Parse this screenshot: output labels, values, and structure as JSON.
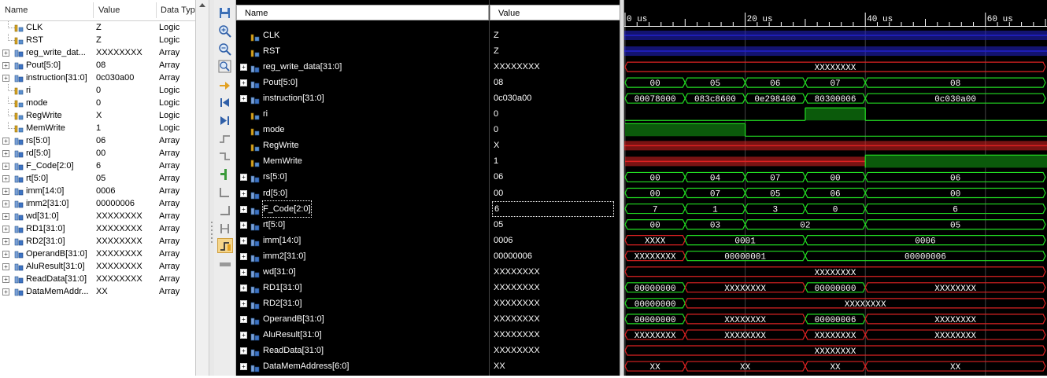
{
  "objects_panel": {
    "columns": [
      "Name",
      "Value",
      "Data Typ"
    ],
    "rows": [
      {
        "name": "CLK",
        "value": "Z",
        "type": "Logic",
        "kind": "logic",
        "expandable": false
      },
      {
        "name": "RST",
        "value": "Z",
        "type": "Logic",
        "kind": "logic",
        "expandable": false
      },
      {
        "name": "reg_write_dat...",
        "value": "XXXXXXXX",
        "type": "Array",
        "kind": "array",
        "expandable": true
      },
      {
        "name": "Pout[5:0]",
        "value": "08",
        "type": "Array",
        "kind": "array",
        "expandable": true
      },
      {
        "name": "instruction[31:0]",
        "value": "0c030a00",
        "type": "Array",
        "kind": "array",
        "expandable": true
      },
      {
        "name": "ri",
        "value": "0",
        "type": "Logic",
        "kind": "logic",
        "expandable": false
      },
      {
        "name": "mode",
        "value": "0",
        "type": "Logic",
        "kind": "logic",
        "expandable": false
      },
      {
        "name": "RegWrite",
        "value": "X",
        "type": "Logic",
        "kind": "logic",
        "expandable": false
      },
      {
        "name": "MemWrite",
        "value": "1",
        "type": "Logic",
        "kind": "logic",
        "expandable": false
      },
      {
        "name": "rs[5:0]",
        "value": "06",
        "type": "Array",
        "kind": "array",
        "expandable": true
      },
      {
        "name": "rd[5:0]",
        "value": "00",
        "type": "Array",
        "kind": "array",
        "expandable": true
      },
      {
        "name": "F_Code[2:0]",
        "value": "6",
        "type": "Array",
        "kind": "array",
        "expandable": true
      },
      {
        "name": "rt[5:0]",
        "value": "05",
        "type": "Array",
        "kind": "array",
        "expandable": true
      },
      {
        "name": "imm[14:0]",
        "value": "0006",
        "type": "Array",
        "kind": "array",
        "expandable": true
      },
      {
        "name": "imm2[31:0]",
        "value": "00000006",
        "type": "Array",
        "kind": "array",
        "expandable": true
      },
      {
        "name": "wd[31:0]",
        "value": "XXXXXXXX",
        "type": "Array",
        "kind": "array",
        "expandable": true
      },
      {
        "name": "RD1[31:0]",
        "value": "XXXXXXXX",
        "type": "Array",
        "kind": "array",
        "expandable": true
      },
      {
        "name": "RD2[31:0]",
        "value": "XXXXXXXX",
        "type": "Array",
        "kind": "array",
        "expandable": true
      },
      {
        "name": "OperandB[31:0]",
        "value": "XXXXXXXX",
        "type": "Array",
        "kind": "array",
        "expandable": true
      },
      {
        "name": "AluResult[31:0]",
        "value": "XXXXXXXX",
        "type": "Array",
        "kind": "array",
        "expandable": true
      },
      {
        "name": "ReadData[31:0]",
        "value": "XXXXXXXX",
        "type": "Array",
        "kind": "array",
        "expandable": true
      },
      {
        "name": "DataMemAddr...",
        "value": "XX",
        "type": "Array",
        "kind": "array",
        "expandable": true
      }
    ]
  },
  "toolbar_icons": [
    "save-icon",
    "zoom-in-icon",
    "zoom-out-icon",
    "zoom-fit-icon",
    "zoom-cursor-icon",
    "go-to-start-icon",
    "go-to-end-icon",
    "previous-transition-icon",
    "next-transition-icon",
    "add-marker-icon",
    "previous-marker-icon",
    "next-marker-icon",
    "swap-cursors-icon",
    "snap-to-transition-icon",
    "floating-ruler-icon"
  ],
  "wave_window": {
    "name_header": "Name",
    "value_header": "Value",
    "colors": {
      "green": "#22dd22",
      "red": "#dd2222",
      "blue": "#2222cc",
      "text": "#ffffff",
      "bg": "#000000",
      "rule": "#ffffff"
    },
    "time": {
      "start": 0,
      "end": 70,
      "unit": "us",
      "major_ticks": [
        0,
        20,
        40,
        60
      ],
      "minor_step": 2,
      "tick_labels": [
        "0 us",
        "20 us",
        "40 us",
        "60 us"
      ]
    },
    "signals": [
      {
        "name": "CLK",
        "value": "Z",
        "kind": "logic",
        "expandable": false,
        "state": "Z",
        "color": "blue"
      },
      {
        "name": "RST",
        "value": "Z",
        "kind": "logic",
        "expandable": false,
        "state": "Z",
        "color": "blue"
      },
      {
        "name": "reg_write_data[31:0]",
        "value": "XXXXXXXX",
        "kind": "array",
        "expandable": true,
        "segments": [
          {
            "t": 0,
            "label": "XXXXXXXX",
            "color": "red"
          }
        ]
      },
      {
        "name": "Pout[5:0]",
        "value": "08",
        "kind": "array",
        "expandable": true,
        "segments": [
          {
            "t": 0,
            "label": "00"
          },
          {
            "t": 10,
            "label": "05"
          },
          {
            "t": 20,
            "label": "06"
          },
          {
            "t": 30,
            "label": "07"
          },
          {
            "t": 40,
            "label": "08"
          }
        ]
      },
      {
        "name": "instruction[31:0]",
        "value": "0c030a00",
        "kind": "array",
        "expandable": true,
        "segments": [
          {
            "t": 0,
            "label": "00078000"
          },
          {
            "t": 10,
            "label": "083c8600"
          },
          {
            "t": 20,
            "label": "0e298400"
          },
          {
            "t": 30,
            "label": "80300006"
          },
          {
            "t": 40,
            "label": "0c030a00"
          }
        ]
      },
      {
        "name": "ri",
        "value": "0",
        "kind": "logic",
        "expandable": false,
        "levels": [
          {
            "t": 0,
            "v": 0
          },
          {
            "t": 30,
            "v": 1
          },
          {
            "t": 40,
            "v": 0
          }
        ]
      },
      {
        "name": "mode",
        "value": "0",
        "kind": "logic",
        "expandable": false,
        "levels": [
          {
            "t": 0,
            "v": 1
          },
          {
            "t": 20,
            "v": 0
          }
        ]
      },
      {
        "name": "RegWrite",
        "value": "X",
        "kind": "logic",
        "expandable": false,
        "state": "X",
        "color": "red"
      },
      {
        "name": "MemWrite",
        "value": "1",
        "kind": "logic",
        "expandable": false,
        "levels": [
          {
            "t": 0,
            "v": "X"
          },
          {
            "t": 40,
            "v": 1
          }
        ]
      },
      {
        "name": "rs[5:0]",
        "value": "06",
        "kind": "array",
        "expandable": true,
        "segments": [
          {
            "t": 0,
            "label": "00"
          },
          {
            "t": 10,
            "label": "04"
          },
          {
            "t": 20,
            "label": "07"
          },
          {
            "t": 30,
            "label": "00"
          },
          {
            "t": 40,
            "label": "06"
          }
        ]
      },
      {
        "name": "rd[5:0]",
        "value": "00",
        "kind": "array",
        "expandable": true,
        "segments": [
          {
            "t": 0,
            "label": "00"
          },
          {
            "t": 10,
            "label": "07"
          },
          {
            "t": 20,
            "label": "05"
          },
          {
            "t": 30,
            "label": "06"
          },
          {
            "t": 40,
            "label": "00"
          }
        ]
      },
      {
        "name": "F_Code[2:0]",
        "value": "6",
        "kind": "array",
        "expandable": true,
        "selected": true,
        "segments": [
          {
            "t": 0,
            "label": "7"
          },
          {
            "t": 10,
            "label": "1"
          },
          {
            "t": 20,
            "label": "3"
          },
          {
            "t": 30,
            "label": "0"
          },
          {
            "t": 40,
            "label": "6"
          }
        ]
      },
      {
        "name": "rt[5:0]",
        "value": "05",
        "kind": "array",
        "expandable": true,
        "segments": [
          {
            "t": 0,
            "label": "00"
          },
          {
            "t": 10,
            "label": "03"
          },
          {
            "t": 20,
            "label": "02"
          },
          {
            "t": 40,
            "label": "05"
          }
        ]
      },
      {
        "name": "imm[14:0]",
        "value": "0006",
        "kind": "array",
        "expandable": true,
        "segments": [
          {
            "t": 0,
            "label": "XXXX",
            "color": "red"
          },
          {
            "t": 10,
            "label": "0001"
          },
          {
            "t": 30,
            "label": "0006"
          }
        ]
      },
      {
        "name": "imm2[31:0]",
        "value": "00000006",
        "kind": "array",
        "expandable": true,
        "segments": [
          {
            "t": 0,
            "label": "XXXXXXXX",
            "color": "red"
          },
          {
            "t": 10,
            "label": "00000001"
          },
          {
            "t": 30,
            "label": "00000006"
          }
        ]
      },
      {
        "name": "wd[31:0]",
        "value": "XXXXXXXX",
        "kind": "array",
        "expandable": true,
        "segments": [
          {
            "t": 0,
            "label": "XXXXXXXX",
            "color": "red"
          }
        ]
      },
      {
        "name": "RD1[31:0]",
        "value": "XXXXXXXX",
        "kind": "array",
        "expandable": true,
        "segments": [
          {
            "t": 0,
            "label": "00000000"
          },
          {
            "t": 10,
            "label": "XXXXXXXX",
            "color": "red"
          },
          {
            "t": 30,
            "label": "00000000"
          },
          {
            "t": 40,
            "label": "XXXXXXXX",
            "color": "red"
          }
        ]
      },
      {
        "name": "RD2[31:0]",
        "value": "XXXXXXXX",
        "kind": "array",
        "expandable": true,
        "segments": [
          {
            "t": 0,
            "label": "00000000"
          },
          {
            "t": 10,
            "label": "XXXXXXXX",
            "color": "red"
          }
        ]
      },
      {
        "name": "OperandB[31:0]",
        "value": "XXXXXXXX",
        "kind": "array",
        "expandable": true,
        "segments": [
          {
            "t": 0,
            "label": "00000000"
          },
          {
            "t": 10,
            "label": "XXXXXXXX",
            "color": "red"
          },
          {
            "t": 30,
            "label": "00000006"
          },
          {
            "t": 40,
            "label": "XXXXXXXX",
            "color": "red"
          }
        ]
      },
      {
        "name": "AluResult[31:0]",
        "value": "XXXXXXXX",
        "kind": "array",
        "expandable": true,
        "segments": [
          {
            "t": 0,
            "label": "XXXXXXXX",
            "color": "red"
          },
          {
            "t": 10,
            "label": "XXXXXXXX",
            "color": "red"
          },
          {
            "t": 30,
            "label": "XXXXXXXX",
            "color": "red"
          },
          {
            "t": 40,
            "label": "XXXXXXXX",
            "color": "red"
          }
        ]
      },
      {
        "name": "ReadData[31:0]",
        "value": "XXXXXXXX",
        "kind": "array",
        "expandable": true,
        "segments": [
          {
            "t": 0,
            "label": "XXXXXXXX",
            "color": "red"
          }
        ]
      },
      {
        "name": "DataMemAddress[6:0]",
        "value": "XX",
        "kind": "array",
        "expandable": true,
        "segments": [
          {
            "t": 0,
            "label": "XX",
            "color": "red"
          },
          {
            "t": 10,
            "label": "XX",
            "color": "red"
          },
          {
            "t": 30,
            "label": "XX",
            "color": "red"
          },
          {
            "t": 40,
            "label": "XX",
            "color": "red"
          }
        ]
      }
    ]
  }
}
